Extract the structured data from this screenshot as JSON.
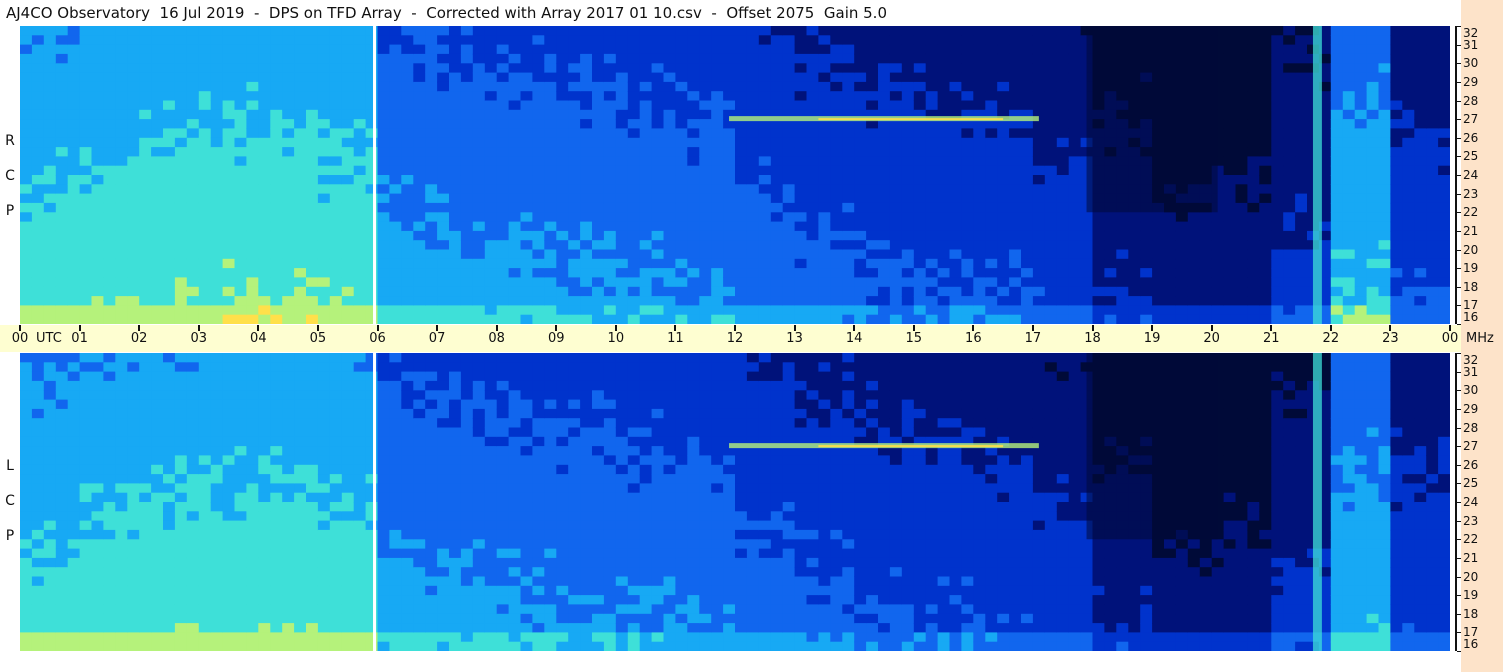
{
  "title": "AJ4CO Observatory  16 Jul 2019  -  DPS on TFD Array  -  Corrected with Array 2017 01 10.csv  -  Offset 2075  Gain 5.0",
  "panels": {
    "top_label": [
      "R",
      "C",
      "P"
    ],
    "bottom_label": [
      "L",
      "C",
      "P"
    ]
  },
  "axis_labels": {
    "time_unit": "UTC",
    "freq_unit": "MHz"
  },
  "colors": {
    "background": "#ffffff",
    "title_bar": "#ffffff",
    "time_axis_band": "#fefed1",
    "right_strip": "#fde3c9",
    "colormap": [
      "#000a38",
      "#00127a",
      "#0033cc",
      "#1166ee",
      "#17a9f4",
      "#3ee0d8",
      "#b5f27b",
      "#ffe04a",
      "#ff5a1a",
      "#ff2a9a"
    ]
  },
  "chart_data": {
    "type": "heatmap",
    "description_type": "dynamic spectrum",
    "x": {
      "label": "UTC",
      "range": [
        0,
        24
      ],
      "tick_labels": [
        "00",
        "01",
        "02",
        "03",
        "04",
        "05",
        "06",
        "07",
        "08",
        "09",
        "10",
        "11",
        "12",
        "13",
        "14",
        "15",
        "16",
        "17",
        "18",
        "19",
        "20",
        "21",
        "22",
        "23",
        "00"
      ]
    },
    "y": {
      "label": "MHz",
      "range": [
        16,
        32
      ],
      "tick_labels": [
        "16",
        "17",
        "18",
        "19",
        "20",
        "21",
        "22",
        "23",
        "24",
        "25",
        "26",
        "27",
        "28",
        "29",
        "30",
        "31",
        "32"
      ]
    },
    "panels": [
      {
        "name": "R C P",
        "background_levels_by_hour": [
          0.58,
          0.6,
          0.61,
          0.62,
          0.62,
          0.6,
          0.45,
          0.44,
          0.43,
          0.42,
          0.41,
          0.4,
          0.36,
          0.33,
          0.31,
          0.3,
          0.29,
          0.26,
          0.18,
          0.12,
          0.14,
          0.22,
          0.52,
          0.28
        ]
      },
      {
        "name": "L C P",
        "background_levels_by_hour": [
          0.56,
          0.58,
          0.59,
          0.6,
          0.6,
          0.58,
          0.44,
          0.43,
          0.42,
          0.41,
          0.4,
          0.39,
          0.35,
          0.32,
          0.3,
          0.29,
          0.28,
          0.25,
          0.17,
          0.11,
          0.13,
          0.21,
          0.5,
          0.27
        ]
      }
    ],
    "features": [
      {
        "kind": "gap",
        "utc": 5.95
      },
      {
        "kind": "broadband_emission",
        "utc_start": 21.7,
        "utc_end": 21.85
      },
      {
        "kind": "band_intensification",
        "freq_mhz": 27,
        "utc_start": 11.9,
        "utc_end": 17.1
      },
      {
        "kind": "dark_region",
        "utc_start": 17.9,
        "utc_end": 20.1,
        "freq_mhz_min": 22,
        "freq_mhz_max": 32
      }
    ]
  }
}
